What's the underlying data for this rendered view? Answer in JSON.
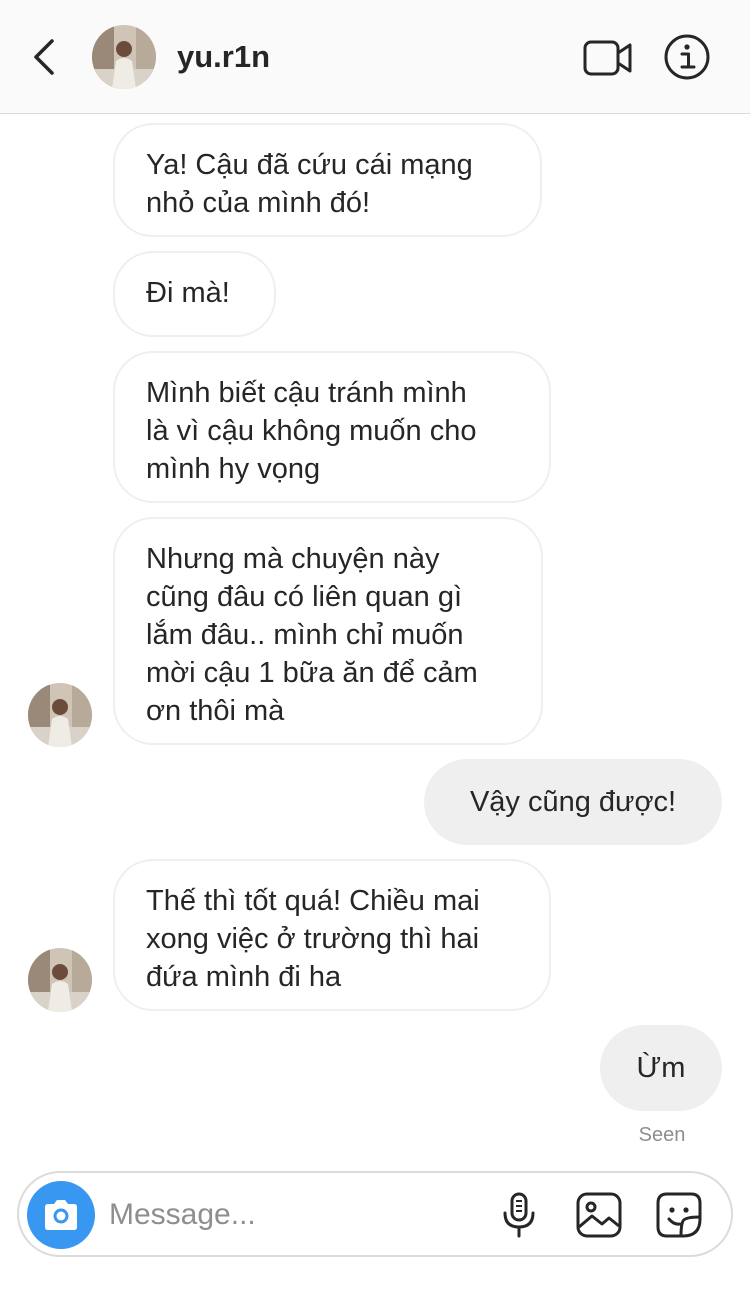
{
  "header": {
    "username": "yu.r1n",
    "icons": {
      "back": "chevron-left-icon",
      "video": "video-camera-icon",
      "info": "info-icon"
    }
  },
  "messages": [
    {
      "direction": "incoming",
      "text": "Ya! Cậu đã cứu cái mạng\nnhỏ của mình đó!",
      "show_avatar": false
    },
    {
      "direction": "incoming",
      "text": "Đi mà!",
      "show_avatar": false
    },
    {
      "direction": "incoming",
      "text": "Mình biết cậu tránh mình\nlà vì cậu không muốn cho\nmình hy vọng",
      "show_avatar": false
    },
    {
      "direction": "incoming",
      "text": "Nhưng mà chuyện này\ncũng đâu có liên quan gì\nlắm đâu.. mình chỉ muốn\nmời cậu 1 bữa ăn để cảm\nơn thôi mà",
      "show_avatar": true
    },
    {
      "direction": "outgoing",
      "text": "Vậy cũng được!",
      "show_avatar": false
    },
    {
      "direction": "incoming",
      "text": "Thế thì tốt quá! Chiều mai\nxong việc ở trường thì hai\nđứa mình đi ha",
      "show_avatar": true
    },
    {
      "direction": "outgoing",
      "text": "Ừm",
      "show_avatar": false
    }
  ],
  "status": {
    "seen": "Seen"
  },
  "composer": {
    "placeholder": "Message...",
    "value": "",
    "icons": {
      "camera": "camera-icon",
      "microphone": "microphone-icon",
      "gallery": "image-icon",
      "sticker": "sticker-icon"
    }
  },
  "colors": {
    "header_bg": "#fafafa",
    "incoming_border": "#efefef",
    "outgoing_bg": "#efefef",
    "accent": "#3897f0",
    "text": "#262626",
    "muted": "#8e8e8e"
  }
}
